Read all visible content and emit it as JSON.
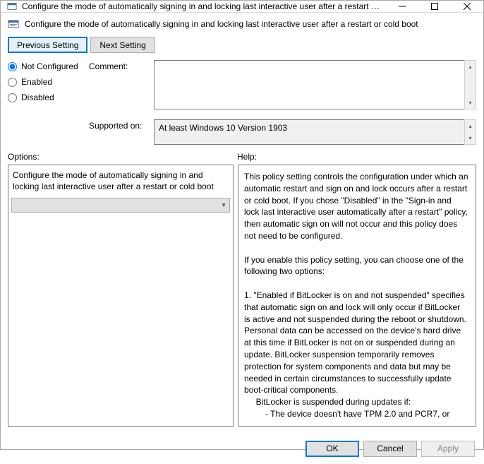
{
  "titlebar": {
    "title": "Configure the mode of automatically signing in and locking last interactive user after a restart or..."
  },
  "header": {
    "text": "Configure the mode of automatically signing in and locking last interactive user after a restart or cold boot"
  },
  "nav": {
    "previous": "Previous Setting",
    "next": "Next Setting"
  },
  "state": {
    "not_configured": "Not Configured",
    "enabled": "Enabled",
    "disabled": "Disabled",
    "selected": "not_configured"
  },
  "fields": {
    "comment_label": "Comment:",
    "comment_value": "",
    "supported_label": "Supported on:",
    "supported_value": "At least Windows 10 Version 1903"
  },
  "panels": {
    "options_label": "Options:",
    "help_label": "Help:"
  },
  "options": {
    "text": "Configure the mode of automatically signing in and locking last interactive user after a restart or cold boot",
    "dropdown_value": ""
  },
  "help": {
    "text": "This policy setting controls the configuration under which an automatic restart and sign on and lock occurs after a restart or cold boot. If you chose \"Disabled\" in the \"Sign-in and lock last interactive user automatically after a restart\" policy, then automatic sign on will not occur and this policy does not need to be configured.\n\nIf you enable this policy setting, you can choose one of the following two options:\n\n1. \"Enabled if BitLocker is on and not suspended\" specifies that automatic sign on and lock will only occur if BitLocker is active and not suspended during the reboot or shutdown. Personal data can be accessed on the device's hard drive at this time if BitLocker is not on or suspended during an update. BitLocker suspension temporarily removes protection for system components and data but may be needed in certain circumstances to successfully update boot-critical components.\n     BitLocker is suspended during updates if:\n         - The device doesn't have TPM 2.0 and PCR7, or"
  },
  "footer": {
    "ok": "OK",
    "cancel": "Cancel",
    "apply": "Apply"
  }
}
